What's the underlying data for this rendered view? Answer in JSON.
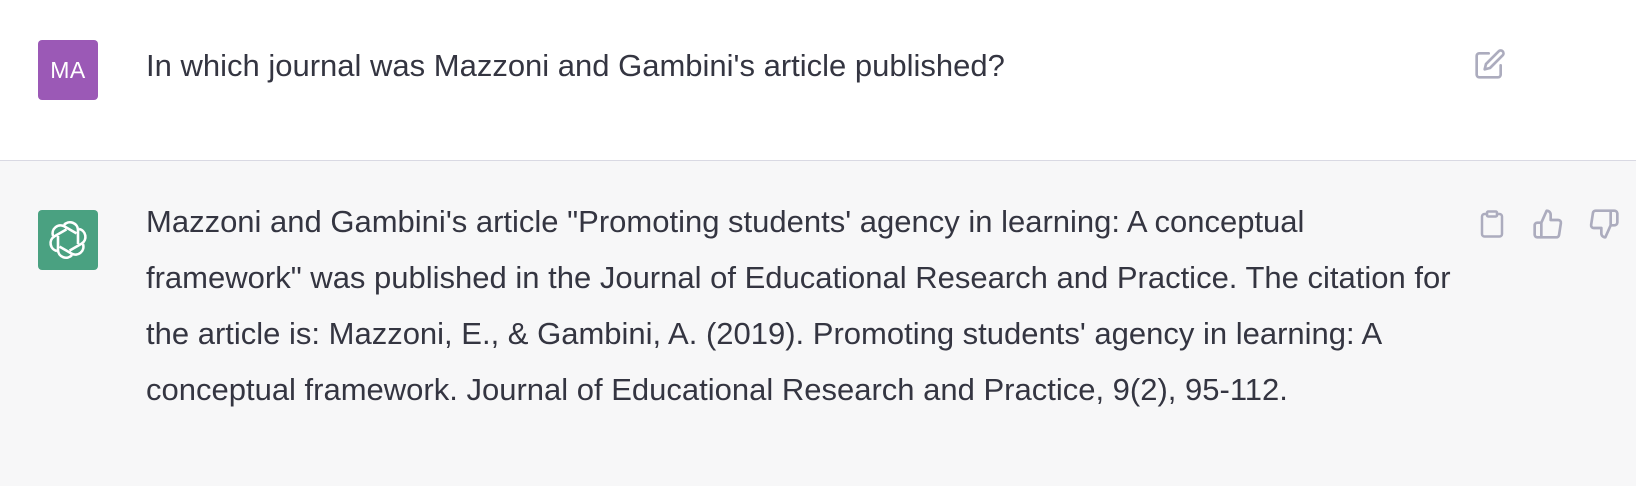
{
  "user_message": {
    "avatar_initials": "MA",
    "avatar_color": "#9b59b6",
    "text": "In which journal was Mazzoni and Gambini's article published?",
    "edit_icon": "edit-icon"
  },
  "assistant_message": {
    "avatar_icon": "openai-logo-icon",
    "avatar_color": "#4aa181",
    "text": "Mazzoni and Gambini's article \"Promoting students' agency in learning: A conceptual framework\" was published in the Journal of Educational Research and Practice. The citation for the article is: Mazzoni, E., & Gambini, A. (2019). Promoting students' agency in learning: A conceptual framework. Journal of Educational Research and Practice, 9(2), 95-112.",
    "actions": [
      "copy-icon",
      "thumbs-up-icon",
      "thumbs-down-icon"
    ]
  }
}
